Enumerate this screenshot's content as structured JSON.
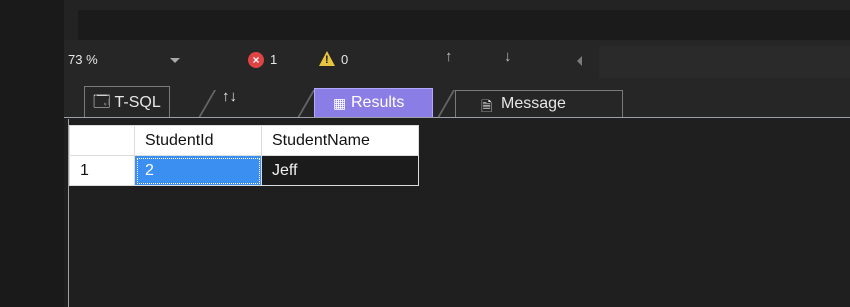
{
  "status": {
    "zoom": "73 %",
    "errors": "1",
    "warnings": "0",
    "colors": {
      "error": "#e04343",
      "warning": "#e7c53f"
    }
  },
  "tabs": {
    "tsql": "T-SQL",
    "sort_glyph": "↑↓",
    "results": "Results",
    "message": "Message",
    "active": "Results",
    "accent": "#8a7ee6"
  },
  "grid": {
    "columns": [
      "StudentId",
      "StudentName"
    ],
    "rows": [
      {
        "row_number": "1",
        "cells": [
          "2",
          "Jeff"
        ]
      }
    ],
    "selected_color": "#3a8ff0"
  }
}
